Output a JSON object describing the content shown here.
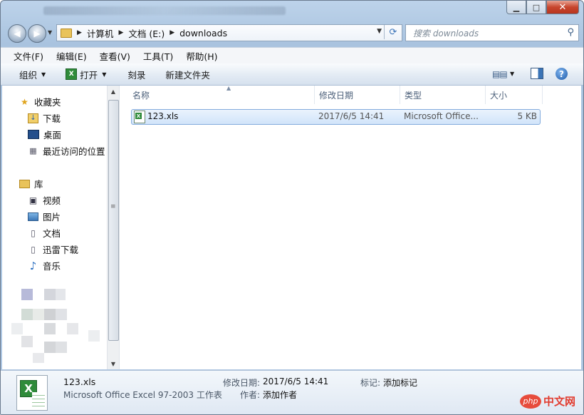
{
  "titlebar": {
    "buttons": [
      "minimize",
      "maximize",
      "close"
    ],
    "min_glyph": "▁",
    "max_glyph": "□",
    "close_glyph": "✕"
  },
  "address": {
    "crumbs": [
      "计算机",
      "文档 (E:)",
      "downloads"
    ],
    "search_placeholder": "搜索 downloads"
  },
  "menu": [
    "文件(F)",
    "编辑(E)",
    "查看(V)",
    "工具(T)",
    "帮助(H)"
  ],
  "toolbar": {
    "organize": "组织",
    "open": "打开",
    "burn": "刻录",
    "new_folder": "新建文件夹"
  },
  "nav": {
    "favorites": "收藏夹",
    "favorite_items": [
      "下载",
      "桌面",
      "最近访问的位置"
    ],
    "libraries": "库",
    "library_items": [
      "视频",
      "图片",
      "文档",
      "迅雷下载",
      "音乐"
    ]
  },
  "columns": {
    "name": "名称",
    "modified": "修改日期",
    "type": "类型",
    "size": "大小"
  },
  "files": [
    {
      "name": "123.xls",
      "modified": "2017/6/5 14:41",
      "type": "Microsoft Office...",
      "size": "5 KB"
    }
  ],
  "details": {
    "name": "123.xls",
    "type_desc": "Microsoft Office Excel 97-2003 工作表",
    "modified_label": "修改日期:",
    "modified_value": "2017/6/5 14:41",
    "tags_label": "标记:",
    "tags_value": "添加标记",
    "author_label": "作者:",
    "author_value": "添加作者"
  },
  "watermark": {
    "badge": "php",
    "site": "中文网"
  },
  "colors": {
    "accent": "#3b74b6",
    "selection": "#d1e4fa",
    "excel": "#2f8b3a"
  }
}
